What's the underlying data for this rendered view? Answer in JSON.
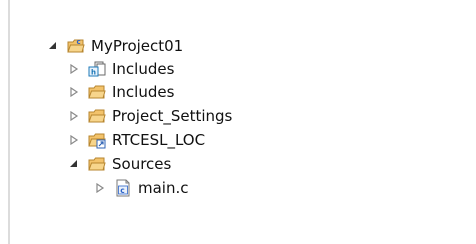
{
  "tree": {
    "root": {
      "label": "MyProject01",
      "icon": "c-project-folder-icon",
      "expanded": true,
      "children": [
        {
          "label": "Includes",
          "icon": "include-library-icon",
          "expanded": false
        },
        {
          "label": "Includes",
          "icon": "folder-icon",
          "expanded": false
        },
        {
          "label": "Project_Settings",
          "icon": "folder-icon",
          "expanded": false
        },
        {
          "label": "RTCESL_LOC",
          "icon": "linked-folder-icon",
          "expanded": false
        },
        {
          "label": "Sources",
          "icon": "folder-icon",
          "expanded": true,
          "children": [
            {
              "label": "main.c",
              "icon": "c-source-file-icon",
              "expanded": false
            }
          ]
        }
      ]
    }
  },
  "colors": {
    "folder": "#f3c36b",
    "folder_outline": "#b7862f",
    "c_project": "#2a62c8",
    "include_badge": "#1e79b8",
    "twisty_expanded": "#333333",
    "twisty_collapsed": "#8a8a8a",
    "linked_overlay": "#2f63b5"
  }
}
